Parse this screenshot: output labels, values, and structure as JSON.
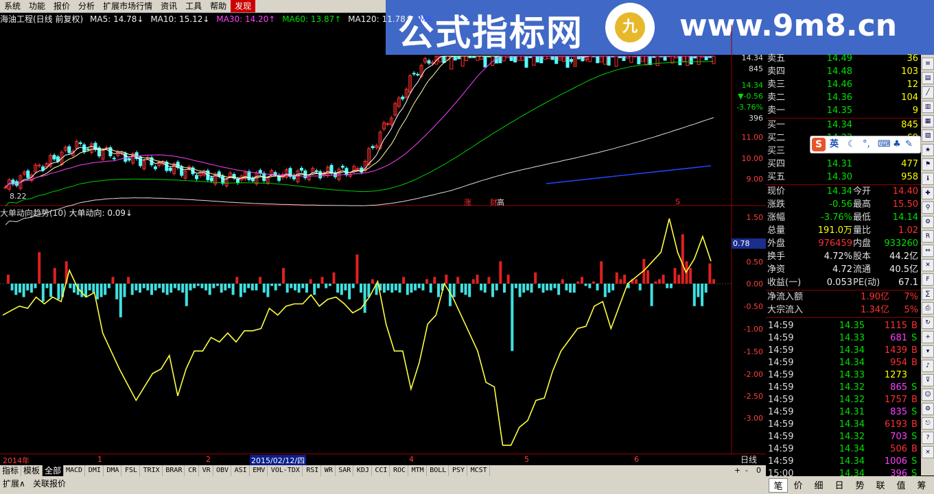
{
  "menu": [
    "系统",
    "功能",
    "报价",
    "分析",
    "扩展市场行情",
    "资讯",
    "工具",
    "帮助",
    "发现"
  ],
  "banner": {
    "left_text": "公式指标网",
    "right_text": "www.9m8.cn",
    "logo_text": "九"
  },
  "ma_line": {
    "title": "海油工程(日线 前复权)",
    "ma5": "MA5: 14.78↓",
    "ma10": "MA10: 15.12↓",
    "ma30": "MA30: 14.20↑",
    "ma60": "MA60: 13.87↑",
    "ma120": "MA120: 11.78↑",
    "ma250": "MA",
    "colors": {
      "ma5": "#ffffff",
      "ma10": "#ffffff",
      "ma30": "#ff40ff",
      "ma60": "#00ff00",
      "ma120": "#ffffff",
      "ma250": "#3355ff"
    }
  },
  "price_axis": [
    "11.00",
    "10.00",
    "9.00"
  ],
  "price_panel_extra": {
    "low_mark": "8.22",
    "signal_zhang": "涨",
    "signal_cai": "财",
    "signal_gao": "高",
    "signal_s": "S"
  },
  "mini_axis": [
    "14.34",
    "845",
    "14.34",
    "▼-0.56",
    "-3.76%",
    "396"
  ],
  "indicator": {
    "title": "大单动向趋势(10)",
    "value_label": "大单动向: 0.09↓",
    "axis": [
      "1.50",
      "1.00",
      "0.50",
      "0.00",
      "-0.50",
      "-1.00",
      "-1.50",
      "-2.00",
      "-2.50",
      "-3.00"
    ],
    "tooltip": "0.78"
  },
  "chart_data": [
    {
      "type": "bar",
      "title": "大单动向趋势(10)",
      "ylim": [
        -3.3,
        1.7
      ],
      "series": [
        {
          "name": "大单动向",
          "values": [
            0.2,
            -0.15,
            -0.25,
            -0.2,
            -0.3,
            -0.15,
            -0.2,
            -0.1,
            0.7,
            -0.4,
            -0.1,
            -0.3,
            0.35,
            -0.35,
            -0.3,
            0.5,
            -0.1,
            -0.2,
            -0.25,
            -0.3,
            -0.3,
            -0.15,
            -0.2,
            -0.35,
            -0.3,
            -0.25,
            -0.1,
            0.15,
            -0.35,
            -0.75,
            -0.3,
            0.15,
            -0.25,
            -0.15,
            -0.2,
            -0.1,
            -0.15,
            -0.25,
            -0.15,
            -0.1,
            -0.2,
            -0.25,
            -0.2,
            -0.1,
            -0.15,
            -0.2,
            -0.5,
            -0.15,
            -0.1,
            -0.05,
            -0.1,
            -0.15,
            -0.25,
            -0.1,
            -0.05,
            -0.2,
            -0.15,
            -0.1,
            -0.25,
            0.15,
            -0.3,
            -0.2,
            -0.1,
            -0.15,
            -0.15,
            0.15,
            -0.2,
            -0.3,
            -0.05,
            -0.15,
            -0.05,
            0.35,
            -0.2,
            -0.1,
            -0.15,
            -0.2,
            -0.1,
            -0.2,
            0.1,
            -0.25,
            -0.1,
            0.15,
            -0.1,
            -0.05,
            0.25,
            -0.2,
            -0.25,
            -0.15,
            -0.35,
            -0.1,
            0.65,
            -0.2,
            -0.65,
            -0.3,
            0.1,
            -0.25,
            -0.15,
            -0.2,
            -0.15,
            -0.2,
            -0.15,
            -0.2,
            0.15,
            -0.25,
            -0.2,
            -0.15,
            -0.1,
            -0.15,
            0.1,
            -0.2,
            0.15,
            -0.3,
            -0.15,
            0.2,
            -0.5,
            -0.3,
            0.15,
            -0.2,
            -0.25,
            -0.3,
            0.1,
            0.2,
            -0.15,
            -0.2,
            0.15,
            -0.3,
            -0.15,
            0.5,
            -0.2,
            0.2,
            -1.5,
            -0.1,
            -0.3,
            -0.2,
            -0.15,
            -0.2,
            0.25,
            -0.1,
            -0.2,
            -0.15,
            -0.15,
            -0.1,
            -0.25,
            0.1,
            -0.15,
            -0.2,
            -0.2,
            0.05,
            0.15,
            -0.05,
            -0.1,
            0.05,
            -0.15,
            0.5,
            -0.3,
            -0.2,
            -0.15,
            0.25,
            0.1,
            0.2,
            -0.1,
            0.1,
            0.1,
            -0.15,
            0.55,
            0.3,
            -0.5,
            0.05,
            0.1,
            0.2,
            -0.1,
            -0.1,
            0.35,
            0.2,
            1.1,
            0.5,
            0.35,
            -0.5,
            -0.3,
            -0.5,
            -0.2,
            0.45,
            0.1
          ]
        },
        {
          "name": "大单动向趋势",
          "values": [
            -0.7,
            -0.6,
            -0.5,
            -0.55,
            -0.3,
            -0.45,
            -0.3,
            -0.4,
            0.3,
            -0.1,
            -0.3,
            -0.2,
            -1.1,
            -1.5,
            -1.9,
            -2.25,
            -2.6,
            -2.3,
            -2.0,
            -1.9,
            -1.6,
            -2.5,
            -1.9,
            -1.5,
            -1.5,
            -1.2,
            -1.3,
            -1.1,
            -1.3,
            -1.05,
            -1.05,
            -1.0,
            -0.55,
            -0.7,
            -0.5,
            -0.45,
            -0.45,
            -0.25,
            -0.5,
            -0.35,
            -0.3,
            -0.45,
            -0.65,
            -0.55,
            -0.3,
            0.05,
            -0.9,
            -1.5,
            -1.5,
            -2.35,
            -1.75,
            -0.9,
            -0.7,
            0.0,
            -0.3,
            -0.7,
            -1.1,
            -1.5,
            -2.2,
            -2.3,
            -3.6,
            -3.6,
            -3.2,
            -3.05,
            -2.6,
            -2.55,
            -1.95,
            -1.5,
            -1.25,
            -1.0,
            -0.95,
            -0.5,
            -0.4,
            -1.0,
            -0.5,
            0.0,
            0.15,
            0.3,
            0.5,
            0.7,
            1.45,
            0.7,
            0.25,
            0.55,
            1.05,
            0.5
          ]
        }
      ]
    }
  ],
  "right_axis_tag": "日线",
  "time_axis": {
    "labels": [
      "2014年",
      "1",
      "2",
      "2015/02/12/四",
      "4",
      "5",
      "6"
    ]
  },
  "quote": {
    "ask": [
      {
        "label": "卖五",
        "price": "14.49",
        "vol": "36"
      },
      {
        "label": "卖四",
        "price": "14.48",
        "vol": "103"
      },
      {
        "label": "卖三",
        "price": "14.46",
        "vol": "12"
      },
      {
        "label": "卖二",
        "price": "14.36",
        "vol": "104"
      },
      {
        "label": "卖一",
        "price": "14.35",
        "vol": "9"
      }
    ],
    "bid": [
      {
        "label": "买一",
        "price": "14.34",
        "vol": "845"
      },
      {
        "label": "买二",
        "price": "14.33",
        "vol": "69"
      },
      {
        "label": "买三",
        "price": "14.32",
        "vol": "..."
      },
      {
        "label": "买四",
        "price": "14.31",
        "vol": "477"
      },
      {
        "label": "买五",
        "price": "14.30",
        "vol": "958"
      }
    ],
    "stats": [
      {
        "k1": "现价",
        "v1": "14.34",
        "k2": "今开",
        "v2": "14.40"
      },
      {
        "k1": "涨跌",
        "v1": "-0.56",
        "k2": "最高",
        "v2": "15.50"
      },
      {
        "k1": "涨幅",
        "v1": "-3.76%",
        "k2": "最低",
        "v2": "14.14"
      },
      {
        "k1": "总量",
        "v1": "191.0万",
        "k2": "量比",
        "v2": "1.02"
      },
      {
        "k1": "外盘",
        "v1": "976459",
        "k2": "内盘",
        "v2": "933260"
      },
      {
        "k1": "换手",
        "v1": "4.72%",
        "k2": "股本",
        "v2": "44.2亿"
      },
      {
        "k1": "净资",
        "v1": "4.72",
        "k2": "流通",
        "v2": "40.5亿"
      },
      {
        "k1": "收益(一)",
        "v1": "0.053",
        "k2": "PE(动)",
        "v2": "67.1"
      }
    ],
    "flow": [
      {
        "k": "净流入额",
        "v": "1.90亿",
        "p": "7%"
      },
      {
        "k": "大宗流入",
        "v": "1.34亿",
        "p": "5%"
      }
    ],
    "ticks": [
      {
        "t": "14:59",
        "p": "14.35",
        "v": "1115",
        "bs": "B"
      },
      {
        "t": "14:59",
        "p": "14.33",
        "v": "681",
        "bs": "S"
      },
      {
        "t": "14:59",
        "p": "14.34",
        "v": "1439",
        "bs": "B"
      },
      {
        "t": "14:59",
        "p": "14.34",
        "v": "954",
        "bs": "B"
      },
      {
        "t": "14:59",
        "p": "14.33",
        "v": "1273",
        "bs": ""
      },
      {
        "t": "14:59",
        "p": "14.32",
        "v": "865",
        "bs": "S"
      },
      {
        "t": "14:59",
        "p": "14.32",
        "v": "1757",
        "bs": "B"
      },
      {
        "t": "14:59",
        "p": "14.31",
        "v": "835",
        "bs": "S"
      },
      {
        "t": "14:59",
        "p": "14.34",
        "v": "6193",
        "bs": "B"
      },
      {
        "t": "14:59",
        "p": "14.32",
        "v": "703",
        "bs": "S"
      },
      {
        "t": "14:59",
        "p": "14.34",
        "v": "506",
        "bs": "B"
      },
      {
        "t": "14:59",
        "p": "14.34",
        "v": "1006",
        "bs": "S"
      },
      {
        "t": "15:00",
        "p": "14.34",
        "v": "396",
        "bs": "S"
      }
    ]
  },
  "ime": {
    "label": "英"
  },
  "tabs": [
    "指标",
    "模板",
    "全部",
    "MACD",
    "DMI",
    "DMA",
    "FSL",
    "TRIX",
    "BRAR",
    "CR",
    "VR",
    "OBV",
    "ASI",
    "EMV",
    "VOL-TDX",
    "RSI",
    "WR",
    "SAR",
    "KDJ",
    "CCI",
    "ROC",
    "MTM",
    "BOLL",
    "PSY",
    "MCST"
  ],
  "zoom": [
    "+",
    "-",
    "0"
  ],
  "status": [
    "扩展∧",
    "关联报价"
  ],
  "bottom_tabs": [
    "笔",
    "价",
    "细",
    "日",
    "势",
    "联",
    "值",
    "筹"
  ]
}
